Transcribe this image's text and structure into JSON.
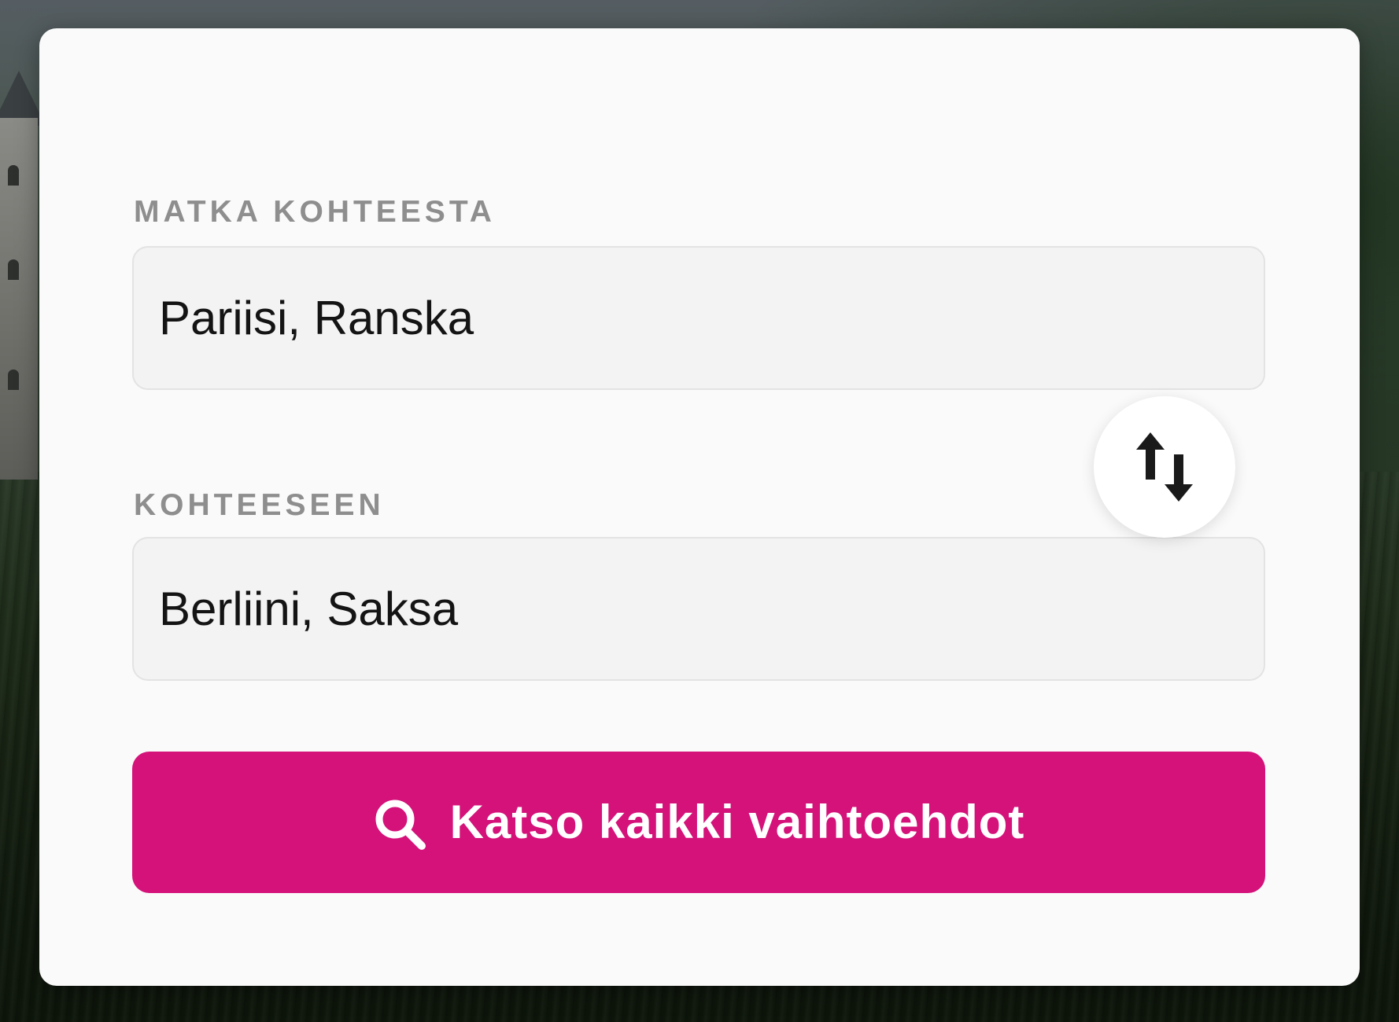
{
  "form": {
    "from_label": "MATKA KOHTEESTA",
    "from_value": "Pariisi, Ranska",
    "to_label": "KOHTEESEEN",
    "to_value": "Berliini, Saksa",
    "swap_icon": "swap-vertical-arrows-icon",
    "search_icon": "search-icon",
    "search_button_label": "Katso kaikki vaihtoehdot"
  },
  "colors": {
    "accent": "#d4127a",
    "card_background": "#fafafa",
    "field_background": "#f3f3f3",
    "label_text": "#8e8e8e",
    "value_text": "#141414"
  }
}
